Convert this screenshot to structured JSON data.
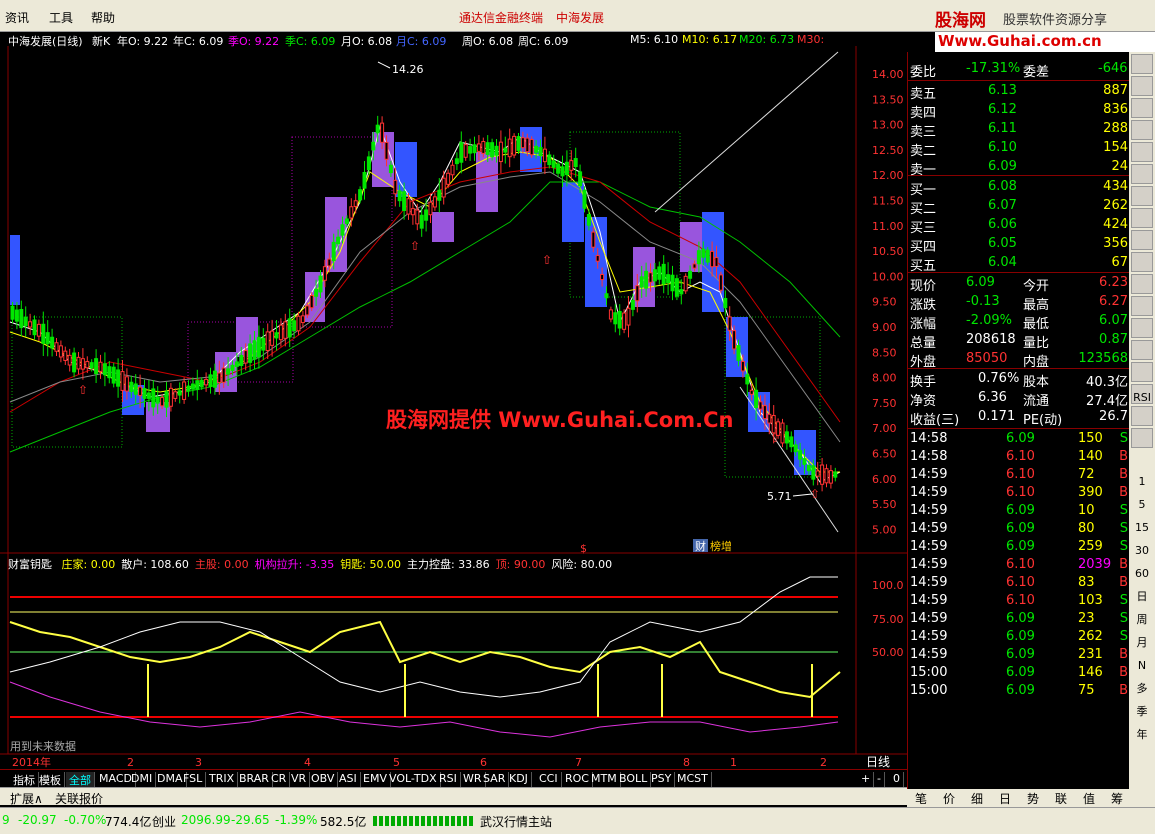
{
  "menu": {
    "items": [
      "资讯",
      "工具",
      "帮助"
    ],
    "center_title": "通达信金融终端",
    "center_stock": "中海发展"
  },
  "watermark": {
    "logo": "股海网",
    "tagline": "股票软件资源分享",
    "url": "Www.Guhai.com.cn",
    "chart_banner": "股海网提供 Www.Guhai.Com.Cn"
  },
  "chart_header": {
    "stock": "中海发展(日线)",
    "newk": "新K",
    "yO": "年O: 9.22",
    "yC": "年C: 6.09",
    "sO": "季O: 9.22",
    "sC": "季C: 6.09",
    "mO": "月O: 6.08",
    "mC": "月C: 6.09",
    "wO": "周O: 6.08",
    "wC": "周C: 6.09",
    "m5": "M5: 6.10",
    "m10": "M10: 6.17",
    "m20": "M20: 6.73",
    "m30": "M30:"
  },
  "price_axis": [
    "14.00",
    "13.50",
    "13.00",
    "12.50",
    "12.00",
    "11.50",
    "11.00",
    "10.50",
    "10.00",
    "9.50",
    "9.00",
    "8.50",
    "8.00",
    "7.50",
    "7.00",
    "6.50",
    "6.00",
    "5.50",
    "5.00"
  ],
  "price_markers": {
    "high": "14.26",
    "low": "5.71",
    "event_tag": "财",
    "event_label": "榜增",
    "dollar": "$"
  },
  "indicator": {
    "name": "财富钥匙",
    "items": [
      {
        "label": "庄家: 0.00",
        "color": "#ffff00"
      },
      {
        "label": "散户: 108.60",
        "color": "#ffffff"
      },
      {
        "label": "主股: 0.00",
        "color": "#ff3232"
      },
      {
        "label": "机构拉升: -3.35",
        "color": "#ff00ff"
      },
      {
        "label": "钥匙: 50.00",
        "color": "#ffff00"
      },
      {
        "label": "主力控盘: 33.86",
        "color": "#ffffff"
      },
      {
        "label": "顶: 90.00",
        "color": "#ff3232"
      },
      {
        "label": "风险: 80.00",
        "color": "#ffffff"
      }
    ],
    "axis": [
      "100.0",
      "75.00",
      "50.00"
    ],
    "future_note": "用到未来数据"
  },
  "time_axis": {
    "labels": [
      "2014年",
      "2",
      "3",
      "4",
      "5",
      "6",
      "7",
      "8",
      "1",
      "2"
    ],
    "period": "日线"
  },
  "tabs": [
    "指标",
    "模板",
    "全部",
    "MACD",
    "DMI",
    "DMA",
    "FSL",
    "TRIX",
    "BRAR",
    "CR",
    "VR",
    "OBV",
    "ASI",
    "EMV",
    "VOL-TDX",
    "RSI",
    "WR",
    "SAR",
    "KDJ",
    "CCI",
    "ROC",
    "MTM",
    "BOLL",
    "PSY",
    "MCST"
  ],
  "tabs_right": [
    "+",
    "-",
    "0"
  ],
  "tabs2": [
    "扩展∧",
    "关联报价"
  ],
  "quote": {
    "weibi_label": "委比",
    "weibi": "-17.31%",
    "weicha_label": "委差",
    "weicha": "-646",
    "asks": [
      {
        "label": "卖五",
        "price": "6.13",
        "vol": "887"
      },
      {
        "label": "卖四",
        "price": "6.12",
        "vol": "836"
      },
      {
        "label": "卖三",
        "price": "6.11",
        "vol": "288"
      },
      {
        "label": "卖二",
        "price": "6.10",
        "vol": "154"
      },
      {
        "label": "卖一",
        "price": "6.09",
        "vol": "24"
      }
    ],
    "bids": [
      {
        "label": "买一",
        "price": "6.08",
        "vol": "434"
      },
      {
        "label": "买二",
        "price": "6.07",
        "vol": "262"
      },
      {
        "label": "买三",
        "price": "6.06",
        "vol": "424"
      },
      {
        "label": "买四",
        "price": "6.05",
        "vol": "356"
      },
      {
        "label": "买五",
        "price": "6.04",
        "vol": "67"
      }
    ],
    "stats": [
      {
        "l1": "现价",
        "v1": "6.09",
        "c1": "#00e600",
        "l2": "今开",
        "v2": "6.23",
        "c2": "#ff3232"
      },
      {
        "l1": "涨跌",
        "v1": "-0.13",
        "c1": "#00e600",
        "l2": "最高",
        "v2": "6.27",
        "c2": "#ff3232"
      },
      {
        "l1": "涨幅",
        "v1": "-2.09%",
        "c1": "#00e600",
        "l2": "最低",
        "v2": "6.07",
        "c2": "#00e600"
      },
      {
        "l1": "总量",
        "v1": "208618",
        "c1": "#ffffff",
        "l2": "量比",
        "v2": "0.87",
        "c2": "#00e600"
      },
      {
        "l1": "外盘",
        "v1": "85050",
        "c1": "#ff3232",
        "l2": "内盘",
        "v2": "123568",
        "c2": "#00e600"
      }
    ],
    "stats2": [
      {
        "l1": "换手",
        "v1": "0.76%",
        "l2": "股本",
        "v2": "40.3亿"
      },
      {
        "l1": "净资",
        "v1": "6.36",
        "l2": "流通",
        "v2": "27.4亿"
      },
      {
        "l1": "收益(三)",
        "v1": "0.171",
        "l2": "PE(动)",
        "v2": "26.7"
      }
    ],
    "ticks": [
      {
        "t": "14:58",
        "p": "6.09",
        "v": "150",
        "s": "S"
      },
      {
        "t": "14:58",
        "p": "6.10",
        "v": "140",
        "s": "B"
      },
      {
        "t": "14:59",
        "p": "6.10",
        "v": "72",
        "s": "B"
      },
      {
        "t": "14:59",
        "p": "6.10",
        "v": "390",
        "s": "B"
      },
      {
        "t": "14:59",
        "p": "6.09",
        "v": "10",
        "s": "S"
      },
      {
        "t": "14:59",
        "p": "6.09",
        "v": "80",
        "s": "S"
      },
      {
        "t": "14:59",
        "p": "6.09",
        "v": "259",
        "s": "S"
      },
      {
        "t": "14:59",
        "p": "6.10",
        "v": "2039",
        "s": "B"
      },
      {
        "t": "14:59",
        "p": "6.10",
        "v": "83",
        "s": "B"
      },
      {
        "t": "14:59",
        "p": "6.10",
        "v": "103",
        "s": "S"
      },
      {
        "t": "14:59",
        "p": "6.09",
        "v": "23",
        "s": "S"
      },
      {
        "t": "14:59",
        "p": "6.09",
        "v": "262",
        "s": "S"
      },
      {
        "t": "14:59",
        "p": "6.09",
        "v": "231",
        "s": "B"
      },
      {
        "t": "15:00",
        "p": "6.09",
        "v": "146",
        "s": "B"
      },
      {
        "t": "15:00",
        "p": "6.09",
        "v": "75",
        "s": "B"
      }
    ]
  },
  "toolstrip": [
    "RSI",
    "1",
    "5",
    "15",
    "30",
    "60",
    "日",
    "周",
    "月",
    "N",
    "多",
    "季",
    "年"
  ],
  "bottom_tabs": [
    "笔",
    "价",
    "细",
    "日",
    "势",
    "联",
    "值",
    "筹"
  ],
  "status": {
    "sh_chg": "9",
    "sh_diff": "-20.97",
    "sh_pct": "-0.70%",
    "sh_amt": "774.4亿",
    "cy_label": "创业",
    "cy_val": "2096.99",
    "cy_diff": "-29.65",
    "cy_pct": "-1.39%",
    "cy_amt": "582.5亿",
    "server": "武汉行情主站"
  }
}
